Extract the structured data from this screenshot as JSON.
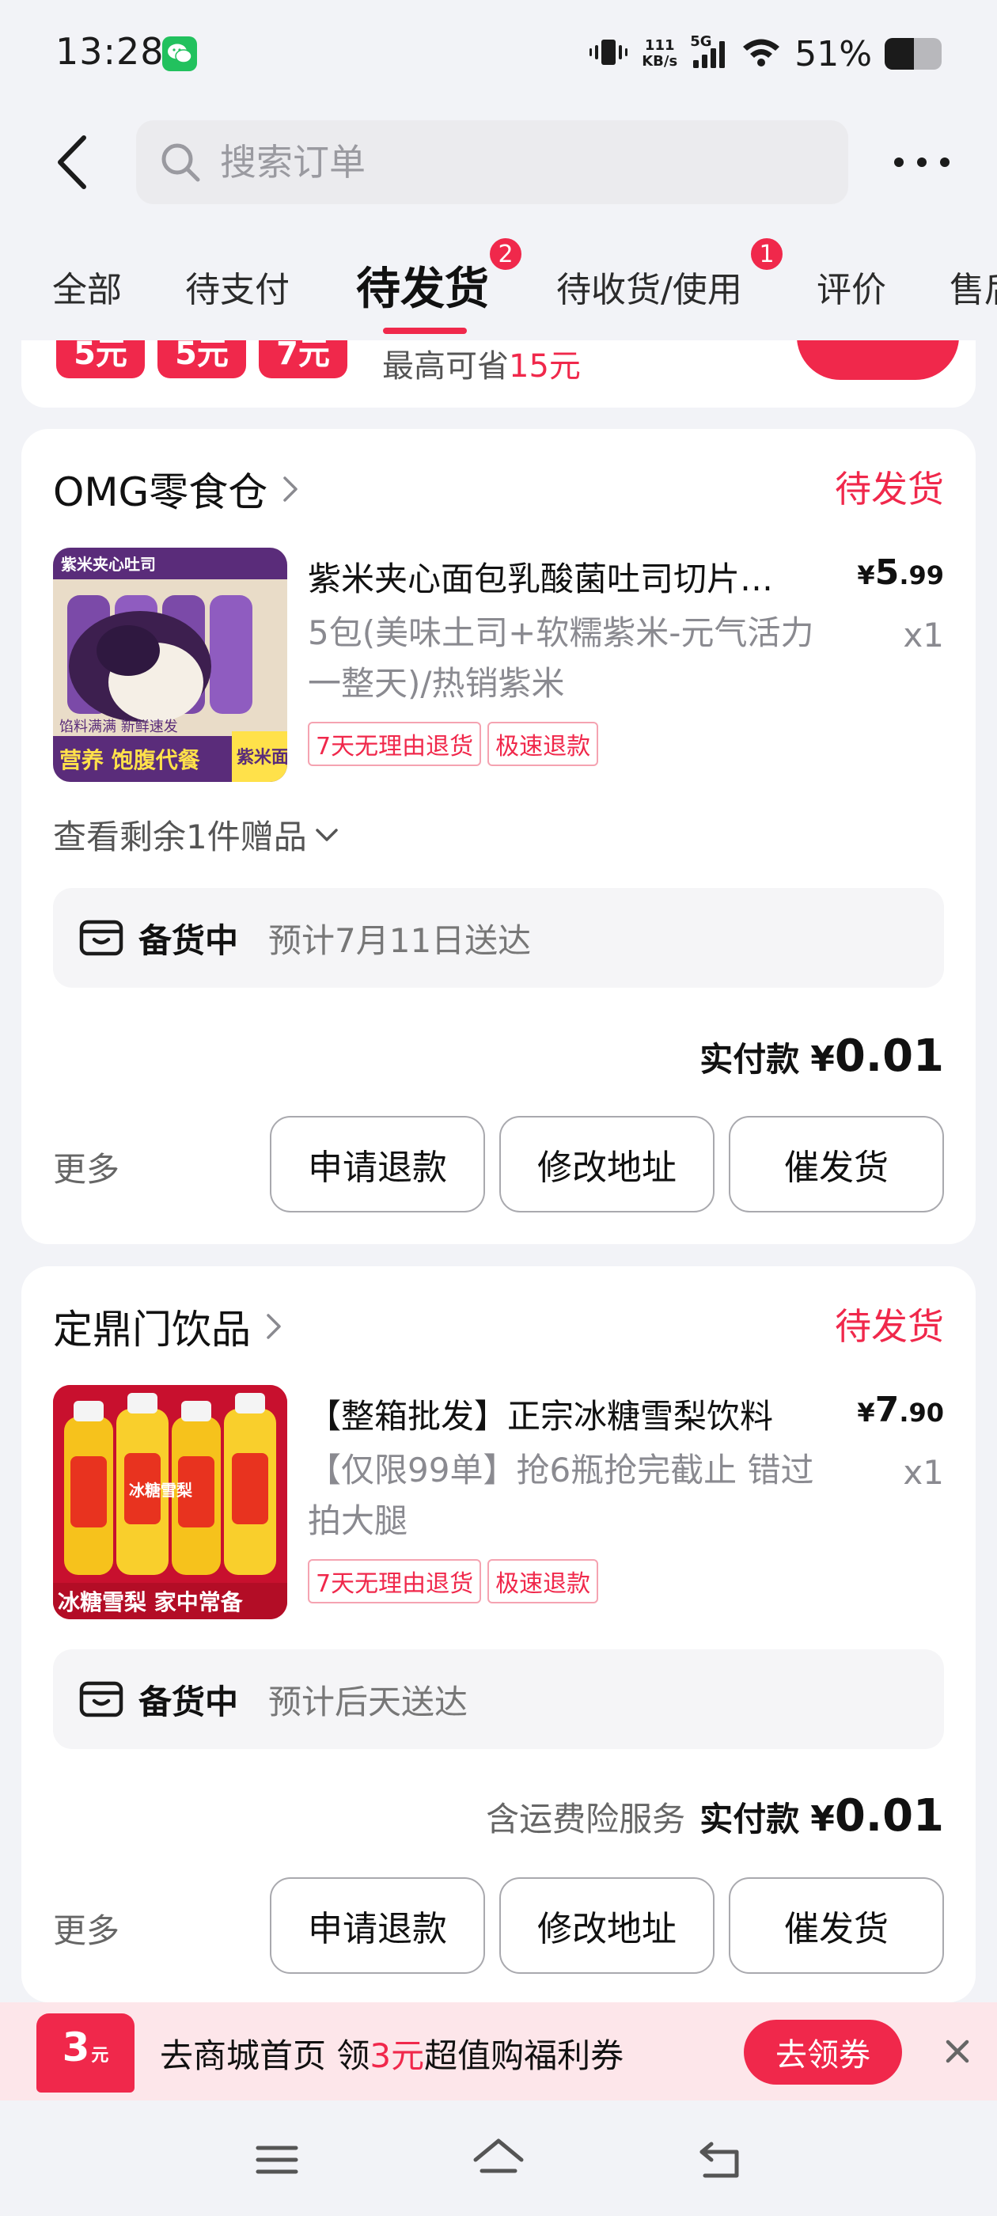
{
  "status_bar": {
    "time": "13:28",
    "net_speed_value": "111",
    "net_speed_unit": "KB/s",
    "network": "5G",
    "battery": "51%",
    "battery_level": 0.51
  },
  "header": {
    "search_placeholder": "搜索订单"
  },
  "tabs": [
    {
      "label": "全部"
    },
    {
      "label": "待支付"
    },
    {
      "label": "待发货",
      "badge": "2",
      "active": true
    },
    {
      "label": "待收货/使用",
      "badge": "1"
    },
    {
      "label": "评价"
    },
    {
      "label": "售后"
    }
  ],
  "promo_strip": {
    "chips": [
      "5元",
      "5元",
      "7元"
    ],
    "save_prefix": "最高可省",
    "save_amount": "15元"
  },
  "orders": [
    {
      "store": "OMG零食仓",
      "status": "待发货",
      "product_title": "紫米夹心面包乳酸菌吐司切片早餐",
      "price_symbol": "¥",
      "price_int": "5",
      "price_dec": ".99",
      "spec": "5包(美味土司+软糯紫米-元气活力一整天)/热销紫米",
      "qty": "x1",
      "chips": [
        "7天无理由退货",
        "极速退款"
      ],
      "gift_link": "查看剩余1件赠品",
      "thumb_text_top": "紫米夹心吐司",
      "thumb_text_mid": "馅料满满 新鲜速发",
      "thumb_text_bottom": "营养 饱腹代餐",
      "thumb_text_side": "紫米面包",
      "ship_state": "备货中",
      "ship_eta": "预计7月11日送达",
      "paid_extra": "",
      "paid_label": "实付款",
      "paid_symbol": "¥",
      "paid_int": "0",
      "paid_dec": ".01",
      "more": "更多",
      "buttons": [
        "申请退款",
        "修改地址",
        "催发货"
      ]
    },
    {
      "store": "定鼎门饮品",
      "status": "待发货",
      "product_title": "【整箱批发】正宗冰糖雪梨饮料",
      "price_symbol": "¥",
      "price_int": "7",
      "price_dec": ".90",
      "spec": "【仅限99单】抢6瓶抢完截止 错过拍大腿",
      "qty": "x1",
      "chips": [
        "7天无理由退货",
        "极速退款"
      ],
      "thumb_text_bottle": "冰糖雪梨",
      "thumb_text_bottom": "冰糖雪梨 家中常备",
      "ship_state": "备货中",
      "ship_eta": "预计后天送达",
      "paid_extra": "含运费险服务",
      "paid_label": "实付款",
      "paid_symbol": "¥",
      "paid_int": "0",
      "paid_dec": ".01",
      "more": "更多",
      "buttons": [
        "申请退款",
        "修改地址",
        "催发货"
      ]
    }
  ],
  "coupon_banner": {
    "tile_amount": "3",
    "tile_unit": "元",
    "text_prefix": "去商城首页 领",
    "text_amount": "3元",
    "text_suffix": "超值购福利券",
    "claim_label": "去领券"
  },
  "colors": {
    "accent": "#f0284b",
    "background": "#f2f3f7",
    "card": "#ffffff",
    "wechat": "#22c15e"
  },
  "icons": [
    "wechat-icon",
    "vibrate-icon",
    "signal-icon",
    "wifi-icon",
    "battery-icon",
    "back-icon",
    "search-icon",
    "more-icon",
    "chevron-right-icon",
    "chevron-down-icon",
    "package-icon",
    "close-icon",
    "menu-icon",
    "home-icon",
    "return-icon"
  ]
}
